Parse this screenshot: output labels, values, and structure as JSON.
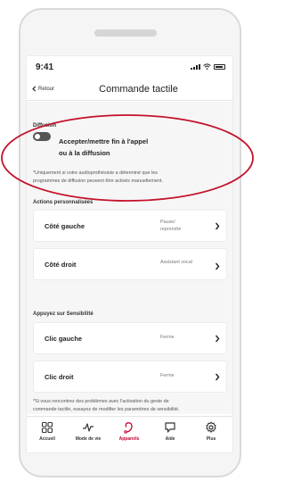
{
  "status": {
    "time": "9:41"
  },
  "header": {
    "back_label": "Retour",
    "title": "Commande tactile"
  },
  "diffusion": {
    "section_label": "Diffusion",
    "toggle_label_line1": "Accepter/mettre fin à l'appel",
    "toggle_label_line2": "ou à la diffusion",
    "toggle_on": false,
    "note_line1": "*Uniquement si votre audioprothésiste a déterminé que les",
    "note_line2": "programmes de diffusion peuvent être activés manuellement."
  },
  "custom_actions": {
    "section_label": "Actions personnalisées",
    "items": [
      {
        "label": "Côté gauche",
        "value_line1": "Pause/",
        "value_line2": "reprendre"
      },
      {
        "label": "Côté droit",
        "value_line1": "Assistant vocal",
        "value_line2": ""
      }
    ]
  },
  "sensitivity": {
    "section_label": "Appuyez sur Sensibilité",
    "items": [
      {
        "label": "Clic gauche",
        "value": "Ferme"
      },
      {
        "label": "Clic droit",
        "value": "Ferme"
      }
    ],
    "note_line1": "*Si vous rencontrez des problèmes avec l'activation du geste de",
    "note_line2": "commande tactile, essayez de modifier les paramètres de sensibilité."
  },
  "tabbar": {
    "items": [
      {
        "label": "Accueil",
        "icon": "home-grid-icon"
      },
      {
        "label": "Mode de vie",
        "icon": "activity-icon"
      },
      {
        "label": "Appareils",
        "icon": "hearing-aid-icon",
        "active": true
      },
      {
        "label": "Aide",
        "icon": "chat-icon"
      },
      {
        "label": "Plus",
        "icon": "gear-icon"
      }
    ]
  },
  "colors": {
    "accent": "#c4002b",
    "annotation": "#c4112b",
    "toggle_off": "#555555"
  }
}
